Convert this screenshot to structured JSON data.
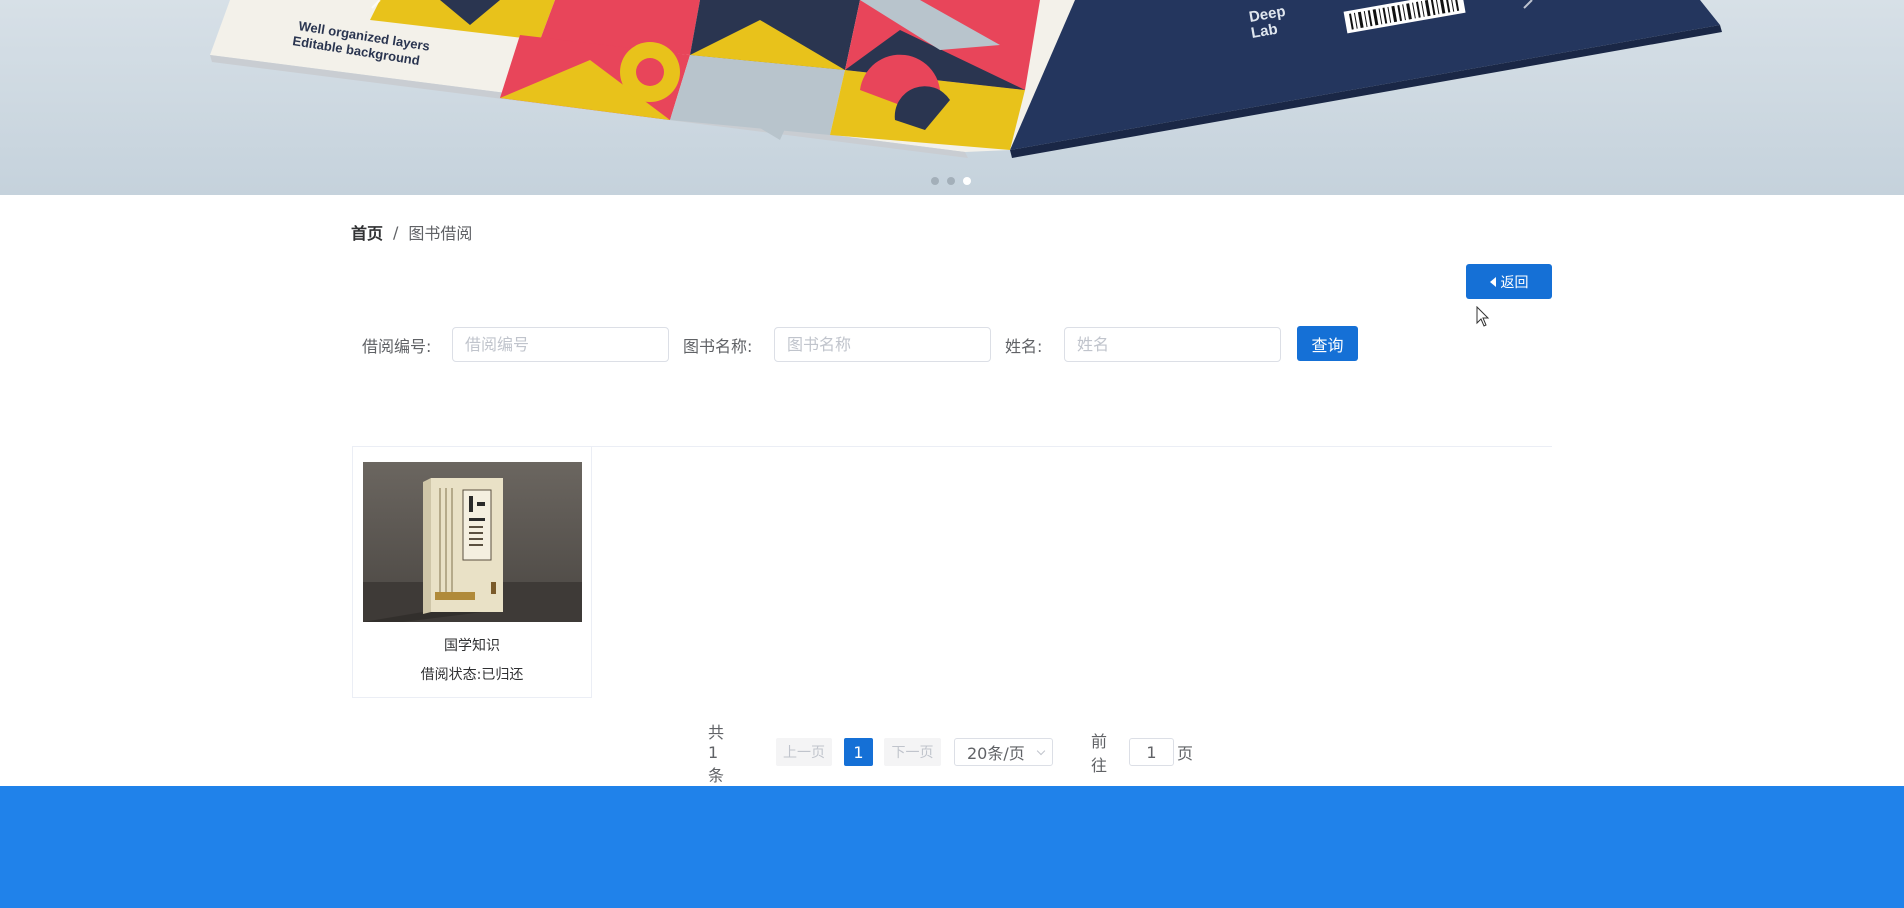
{
  "banner": {
    "image_text_1": "Well organized layers",
    "image_text_2": "Editable background",
    "image_brand_1": "Deep",
    "image_brand_2": "Lab",
    "carousel_dots": 3,
    "active_dot": 3
  },
  "breadcrumb": {
    "home": "首页",
    "separator": "/",
    "current": "图书借阅"
  },
  "back_button": {
    "label": "返回",
    "icon": "caret-left-icon"
  },
  "search": {
    "borrow_id_label": "借阅编号:",
    "borrow_id_placeholder": "借阅编号",
    "borrow_id_value": "",
    "book_name_label": "图书名称:",
    "book_name_placeholder": "图书名称",
    "book_name_value": "",
    "name_label": "姓名:",
    "name_placeholder": "姓名",
    "name_value": "",
    "query_button": "查询"
  },
  "books": [
    {
      "title": "国学知识",
      "status": "借阅状态:已归还"
    }
  ],
  "pagination": {
    "total": "共 1 条",
    "prev": "上一页",
    "current_page": "1",
    "next": "下一页",
    "page_size": "20条/页",
    "goto_label": "前往",
    "goto_value": "1",
    "page_unit": "页"
  },
  "colors": {
    "primary": "#1570d6",
    "footer": "#2082ea"
  }
}
